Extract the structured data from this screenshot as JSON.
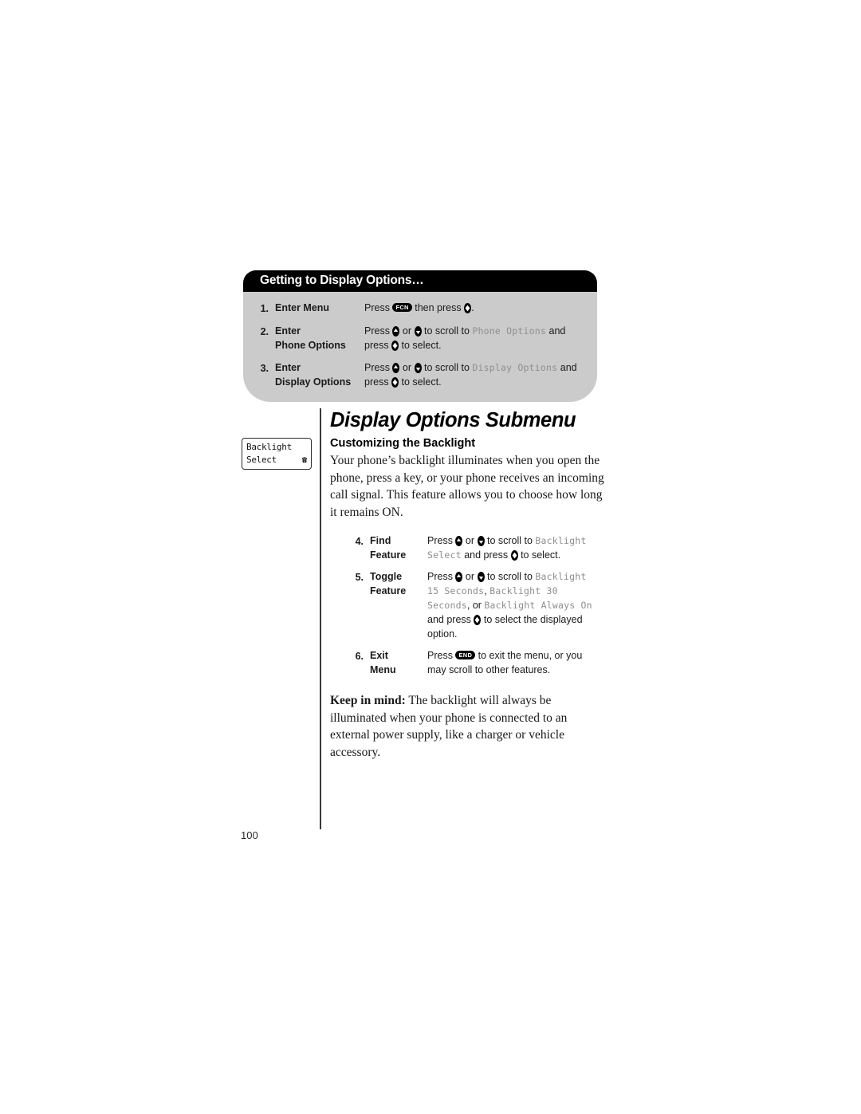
{
  "callout": {
    "title": "Getting to Display Options…",
    "steps": [
      {
        "num": "1.",
        "label": "Enter Menu",
        "parts": [
          {
            "t": "text",
            "v": "Press "
          },
          {
            "t": "pill",
            "v": "FCN"
          },
          {
            "t": "text",
            "v": " then press "
          },
          {
            "t": "key",
            "v": "select"
          },
          {
            "t": "text",
            "v": "."
          }
        ]
      },
      {
        "num": "2.",
        "label": "Enter\nPhone Options",
        "parts": [
          {
            "t": "text",
            "v": "Press "
          },
          {
            "t": "key",
            "v": "up"
          },
          {
            "t": "text",
            "v": " or "
          },
          {
            "t": "key",
            "v": "down"
          },
          {
            "t": "text",
            "v": " to scroll to "
          },
          {
            "t": "lcd",
            "v": "Phone Options"
          },
          {
            "t": "text",
            "v": " and press "
          },
          {
            "t": "key",
            "v": "select"
          },
          {
            "t": "text",
            "v": " to select."
          }
        ]
      },
      {
        "num": "3.",
        "label": "Enter\nDisplay Options",
        "parts": [
          {
            "t": "text",
            "v": "Press "
          },
          {
            "t": "key",
            "v": "up"
          },
          {
            "t": "text",
            "v": " or "
          },
          {
            "t": "key",
            "v": "down"
          },
          {
            "t": "text",
            "v": " to scroll to "
          },
          {
            "t": "lcd",
            "v": "Display Options"
          },
          {
            "t": "text",
            "v": " and press "
          },
          {
            "t": "key",
            "v": "select"
          },
          {
            "t": "text",
            "v": " to select."
          }
        ]
      }
    ]
  },
  "phone_screen": {
    "line1": "Backlight",
    "line2": "Select",
    "icon": "☎"
  },
  "page": {
    "title": "Display Options Submenu",
    "section_heading": "Customizing the Backlight",
    "intro": "Your phone’s backlight illuminates when you open the phone, press a key, or your phone receives an incoming call signal. This feature allows you to choose how long it remains ON.",
    "keep_in_mind_label": "Keep in mind:",
    "keep_in_mind_text": " The backlight will always be illuminated when your phone is connected to an external power supply, like a charger or vehicle accessory.",
    "page_number": "100"
  },
  "lower_steps": [
    {
      "num": "4.",
      "label": "Find\nFeature",
      "parts": [
        {
          "t": "text",
          "v": "Press "
        },
        {
          "t": "key",
          "v": "up"
        },
        {
          "t": "text",
          "v": " or "
        },
        {
          "t": "key",
          "v": "down"
        },
        {
          "t": "text",
          "v": " to scroll to "
        },
        {
          "t": "lcd",
          "v": "Backlight Select"
        },
        {
          "t": "text",
          "v": " and press "
        },
        {
          "t": "key",
          "v": "select"
        },
        {
          "t": "text",
          "v": " to select."
        }
      ]
    },
    {
      "num": "5.",
      "label": "Toggle\nFeature",
      "parts": [
        {
          "t": "text",
          "v": "Press "
        },
        {
          "t": "key",
          "v": "up"
        },
        {
          "t": "text",
          "v": " or "
        },
        {
          "t": "key",
          "v": "down"
        },
        {
          "t": "text",
          "v": " to scroll to "
        },
        {
          "t": "lcd",
          "v": "Backlight 15 Seconds"
        },
        {
          "t": "text",
          "v": ", "
        },
        {
          "t": "lcd",
          "v": "Backlight 30 Seconds"
        },
        {
          "t": "text",
          "v": ", or "
        },
        {
          "t": "lcd",
          "v": "Backlight Always On"
        },
        {
          "t": "text",
          "v": " and press "
        },
        {
          "t": "key",
          "v": "select"
        },
        {
          "t": "text",
          "v": " to select the displayed option."
        }
      ]
    },
    {
      "num": "6.",
      "label": "Exit\nMenu",
      "parts": [
        {
          "t": "text",
          "v": "Press "
        },
        {
          "t": "pill",
          "v": "END"
        },
        {
          "t": "text",
          "v": " to exit the menu, or you may scroll to other features."
        }
      ]
    }
  ],
  "colors": {
    "callout_header_bg": "#000000",
    "callout_body_bg": "#cbcbcb",
    "lcd_text": "#8e8e8e",
    "rule": "#3a3a3a"
  }
}
